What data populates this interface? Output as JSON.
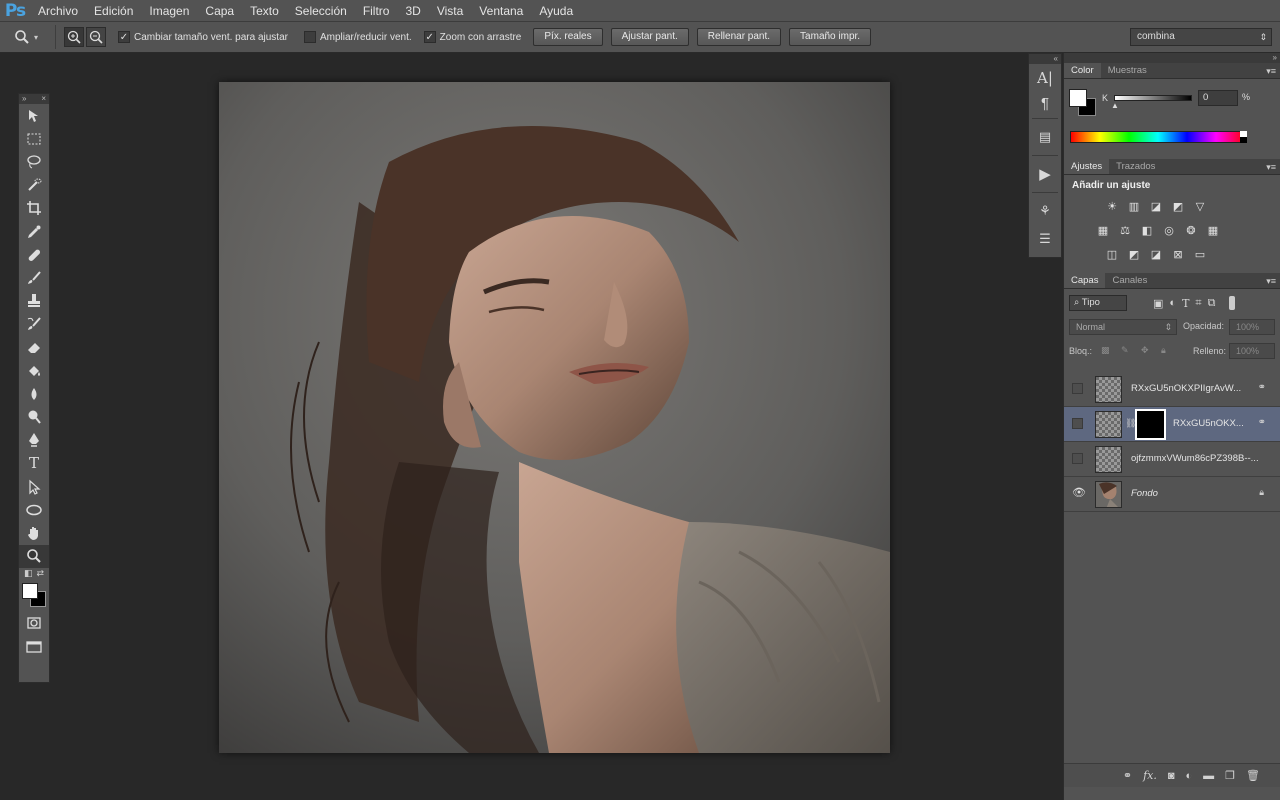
{
  "app": {
    "logo": "Ps"
  },
  "menu": [
    "Archivo",
    "Edición",
    "Imagen",
    "Capa",
    "Texto",
    "Selección",
    "Filtro",
    "3D",
    "Vista",
    "Ventana",
    "Ayuda"
  ],
  "options": {
    "tool_icon": "zoom-icon",
    "resize_windows": {
      "label": "Cambiar tamaño vent. para ajustar",
      "checked": true
    },
    "zoom_all": {
      "label": "Ampliar/reducir vent.",
      "checked": false
    },
    "scrubby_zoom": {
      "label": "Zoom con arrastre",
      "checked": true
    },
    "buttons": [
      "Píx. reales",
      "Ajustar pant.",
      "Rellenar pant.",
      "Tamaño impr."
    ],
    "workspace": "combina"
  },
  "color_panel": {
    "tabs": [
      "Color",
      "Muestras"
    ],
    "channel": "K",
    "value": "0",
    "unit": "%",
    "foreground": "#ffffff",
    "background": "#000000"
  },
  "adjustments_panel": {
    "tabs": [
      "Ajustes",
      "Trazados"
    ],
    "title": "Añadir un ajuste"
  },
  "layers_panel": {
    "tabs": [
      "Capas",
      "Canales"
    ],
    "filter": "Tipo",
    "blend_mode": "Normal",
    "opacity_label": "Opacidad:",
    "opacity": "100%",
    "lock_label": "Bloq.:",
    "fill_label": "Relleno:",
    "fill": "100%",
    "layers": [
      {
        "name": "RXxGU5nOKXPIIgrAvW...",
        "visible": false,
        "selected": false,
        "has_mask": false
      },
      {
        "name": "RXxGU5nOKX...",
        "visible": false,
        "selected": true,
        "has_mask": true
      },
      {
        "name": "ojfzmmxVWum86cPZ398B--...",
        "visible": false,
        "selected": false,
        "has_mask": false
      },
      {
        "name": "Fondo",
        "visible": true,
        "selected": false,
        "has_mask": false,
        "locked": true
      }
    ]
  }
}
